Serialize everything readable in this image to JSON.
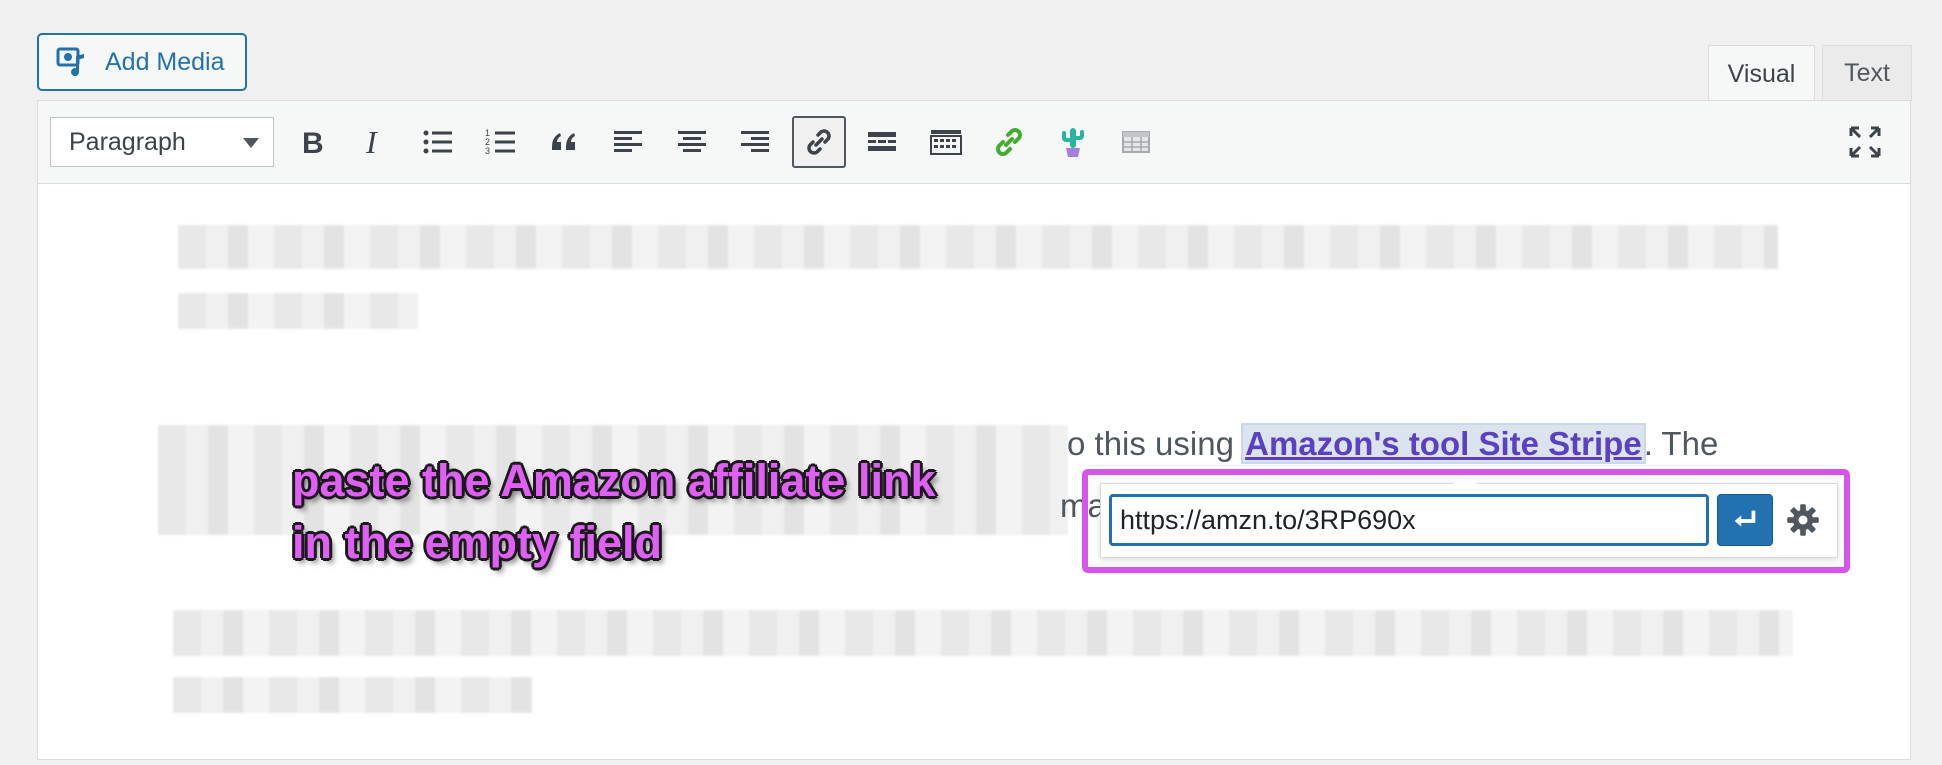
{
  "add_media": {
    "label": "Add Media"
  },
  "tabs": {
    "visual": "Visual",
    "text": "Text"
  },
  "toolbar": {
    "format_select": "Paragraph",
    "buttons": [
      "bold-icon",
      "italic-icon",
      "bulleted-list-icon",
      "numbered-list-icon",
      "blockquote-icon",
      "align-left-icon",
      "align-center-icon",
      "align-right-icon",
      "link-icon",
      "read-more-icon",
      "toolbar-toggle-icon",
      "affiliate-link-icon",
      "cactus-icon",
      "table-icon"
    ],
    "active_button": "link-icon"
  },
  "content": {
    "text_before": "o this using ",
    "link_text": "Amazon's tool Site Stripe",
    "text_after": ". The",
    "line2_fragment": "ma"
  },
  "link_popover": {
    "url_value": "https://amzn.to/3RP690x",
    "submit": "enter-icon",
    "settings": "gear-icon"
  },
  "annotation": {
    "line1": "paste the Amazon affiliate link",
    "line2": "in the empty field"
  },
  "colors": {
    "accent": "#2271b1",
    "annotation": "#e060f5",
    "highlight_frame": "#d654ec",
    "link": "#5b3fc4"
  }
}
